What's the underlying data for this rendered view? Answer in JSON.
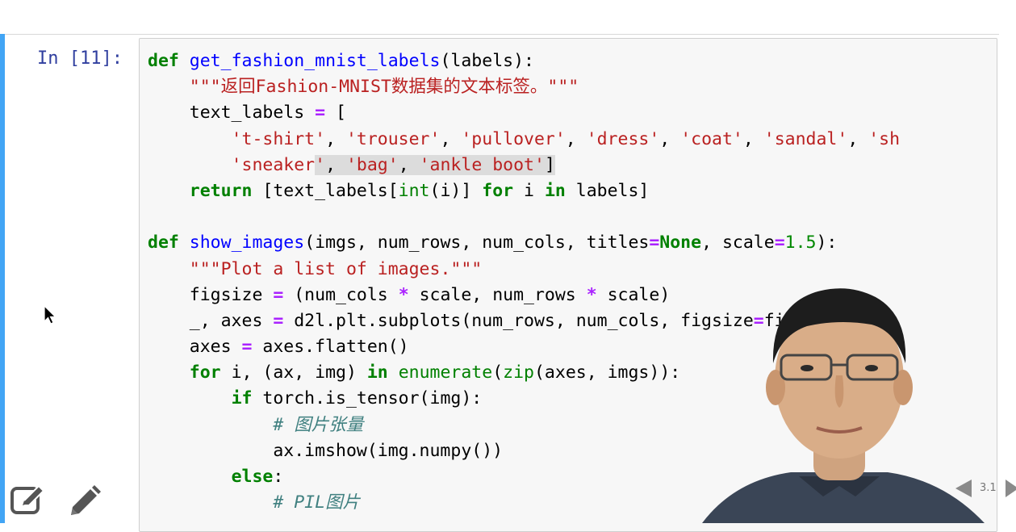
{
  "cell": {
    "prompt": "In [11]:",
    "lines": [
      [
        {
          "t": "def",
          "c": "kw"
        },
        {
          "t": " "
        },
        {
          "t": "get_fashion_mnist_labels",
          "c": "fn"
        },
        {
          "t": "(labels):"
        }
      ],
      [
        {
          "t": "    "
        },
        {
          "t": "\"\"\"返回Fashion-MNIST数据集的文本标签。\"\"\"",
          "c": "str"
        }
      ],
      [
        {
          "t": "    text_labels "
        },
        {
          "t": "=",
          "c": "op"
        },
        {
          "t": " ["
        }
      ],
      [
        {
          "t": "        "
        },
        {
          "t": "'t-shirt'",
          "c": "str"
        },
        {
          "t": ", "
        },
        {
          "t": "'trouser'",
          "c": "str"
        },
        {
          "t": ", "
        },
        {
          "t": "'pullover'",
          "c": "str"
        },
        {
          "t": ", "
        },
        {
          "t": "'dress'",
          "c": "str"
        },
        {
          "t": ", "
        },
        {
          "t": "'coat'",
          "c": "str"
        },
        {
          "t": ", "
        },
        {
          "t": "'sandal'",
          "c": "str"
        },
        {
          "t": ", "
        },
        {
          "t": "'sh",
          "c": "str"
        }
      ],
      [
        {
          "t": "        "
        },
        {
          "t": "'sneaker",
          "c": "str"
        },
        {
          "t": "'",
          "c": "str sel"
        },
        {
          "t": ", ",
          "c": "sel"
        },
        {
          "t": "'bag'",
          "c": "str sel"
        },
        {
          "t": ", ",
          "c": "sel"
        },
        {
          "t": "'ankle boot'",
          "c": "str sel"
        },
        {
          "t": "]",
          "c": "sel"
        }
      ],
      [
        {
          "t": "    "
        },
        {
          "t": "return",
          "c": "kw"
        },
        {
          "t": " [text_labels["
        },
        {
          "t": "int",
          "c": "bi"
        },
        {
          "t": "(i)] "
        },
        {
          "t": "for",
          "c": "kw"
        },
        {
          "t": " i "
        },
        {
          "t": "in",
          "c": "kw"
        },
        {
          "t": " labels]"
        }
      ],
      [
        {
          "t": ""
        }
      ],
      [
        {
          "t": "def",
          "c": "kw"
        },
        {
          "t": " "
        },
        {
          "t": "show_images",
          "c": "fn"
        },
        {
          "t": "(imgs, num_rows, num_cols, titles"
        },
        {
          "t": "=",
          "c": "op"
        },
        {
          "t": "None",
          "c": "kw"
        },
        {
          "t": ", scale"
        },
        {
          "t": "=",
          "c": "op"
        },
        {
          "t": "1.5",
          "c": "num"
        },
        {
          "t": "):"
        }
      ],
      [
        {
          "t": "    "
        },
        {
          "t": "\"\"\"Plot a list of images.\"\"\"",
          "c": "str"
        }
      ],
      [
        {
          "t": "    figsize "
        },
        {
          "t": "=",
          "c": "op"
        },
        {
          "t": " (num_cols "
        },
        {
          "t": "*",
          "c": "op"
        },
        {
          "t": " scale, num_rows "
        },
        {
          "t": "*",
          "c": "op"
        },
        {
          "t": " scale)"
        }
      ],
      [
        {
          "t": "    _, axes "
        },
        {
          "t": "=",
          "c": "op"
        },
        {
          "t": " d2l.plt.subplots(num_rows, num_cols, figsize"
        },
        {
          "t": "=",
          "c": "op"
        },
        {
          "t": "figsize)"
        }
      ],
      [
        {
          "t": "    axes "
        },
        {
          "t": "=",
          "c": "op"
        },
        {
          "t": " axes.flatten()"
        }
      ],
      [
        {
          "t": "    "
        },
        {
          "t": "for",
          "c": "kw"
        },
        {
          "t": " i, (ax, img) "
        },
        {
          "t": "in",
          "c": "kw"
        },
        {
          "t": " "
        },
        {
          "t": "enumerate",
          "c": "bi"
        },
        {
          "t": "("
        },
        {
          "t": "zip",
          "c": "bi"
        },
        {
          "t": "(axes, imgs)):"
        }
      ],
      [
        {
          "t": "        "
        },
        {
          "t": "if",
          "c": "kw"
        },
        {
          "t": " torch.is_tensor(img):"
        }
      ],
      [
        {
          "t": "            "
        },
        {
          "t": "# 图片张量",
          "c": "cm"
        }
      ],
      [
        {
          "t": "            ax.imshow(img.numpy())"
        }
      ],
      [
        {
          "t": "        "
        },
        {
          "t": "else",
          "c": "kw"
        },
        {
          "t": ":"
        }
      ],
      [
        {
          "t": "            "
        },
        {
          "t": "# PIL图片",
          "c": "cm"
        }
      ]
    ]
  },
  "nav": {
    "slide_number": "3.1"
  },
  "icons": [
    "cursor-icon",
    "edit-icon",
    "pencil-icon",
    "chevron-left-icon",
    "chevron-right-icon"
  ],
  "colors": {
    "cell_bar": "#42a5f5",
    "keyword": "#008000",
    "function": "#0000ff",
    "string": "#ba2121",
    "prompt": "#303f9f"
  }
}
